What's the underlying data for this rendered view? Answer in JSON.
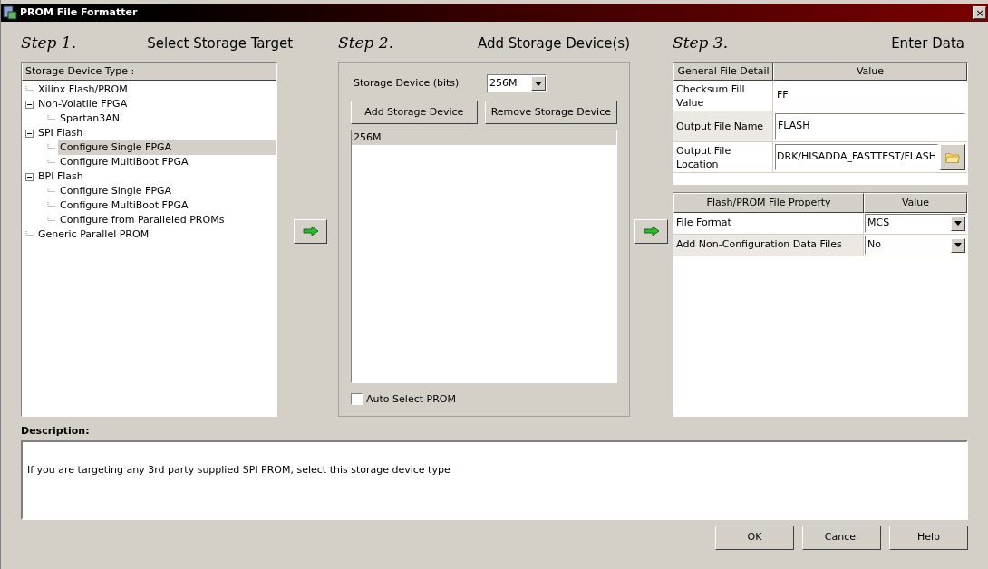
{
  "window": {
    "title": "PROM File Formatter",
    "close": "×"
  },
  "steps": [
    {
      "step": "Step 1.",
      "title": "Select Storage Target"
    },
    {
      "step": "Step 2.",
      "title": "Add Storage Device(s)"
    },
    {
      "step": "Step 3.",
      "title": "Enter Data"
    }
  ],
  "tree": {
    "header": "Storage Device Type :",
    "items": [
      {
        "label": "Xilinx Flash/PROM",
        "selected": false
      },
      {
        "label": "Non-Volatile FPGA",
        "selected": false,
        "expanded": true,
        "children": [
          {
            "label": "Spartan3AN",
            "selected": false
          }
        ]
      },
      {
        "label": "SPI Flash",
        "selected": false,
        "expanded": true,
        "children": [
          {
            "label": "Configure Single FPGA",
            "selected": true
          },
          {
            "label": "Configure MultiBoot FPGA",
            "selected": false
          }
        ]
      },
      {
        "label": "BPI Flash",
        "selected": false,
        "expanded": true,
        "children": [
          {
            "label": "Configure Single FPGA",
            "selected": false
          },
          {
            "label": "Configure MultiBoot FPGA",
            "selected": false
          },
          {
            "label": "Configure from Paralleled PROMs",
            "selected": false
          }
        ]
      },
      {
        "label": "Generic Parallel PROM",
        "selected": false
      }
    ]
  },
  "devices": {
    "size_label": "Storage Device (bits)",
    "size_value": "256M",
    "buttons": [
      "Add Storage Device",
      "Remove Storage Device"
    ],
    "list": [
      {
        "label": "256M",
        "selected": true
      }
    ],
    "auto_select": {
      "label": "Auto Select PROM",
      "checked": false
    }
  },
  "general_table": {
    "columns": [
      "General File Detail",
      "Value"
    ],
    "rows": [
      {
        "label": "Checksum Fill Value",
        "value": "FF",
        "kind": "text"
      },
      {
        "label": "Output File Name",
        "value": "FLASH",
        "kind": "input"
      },
      {
        "label": "Output File Location",
        "value": "DRK/HISADDA_FASTTEST/FLASH",
        "kind": "browse"
      }
    ]
  },
  "property_table": {
    "columns": [
      "Flash/PROM File Property",
      "Value"
    ],
    "rows": [
      {
        "label": "File Format",
        "value": "MCS"
      },
      {
        "label": "Add Non-Configuration Data Files",
        "value": "No"
      }
    ]
  },
  "description": {
    "label": "Description:",
    "text": "If you are targeting any 3rd party supplied SPI PROM, select this storage device type"
  },
  "buttons": [
    "OK",
    "Cancel",
    "Help"
  ]
}
